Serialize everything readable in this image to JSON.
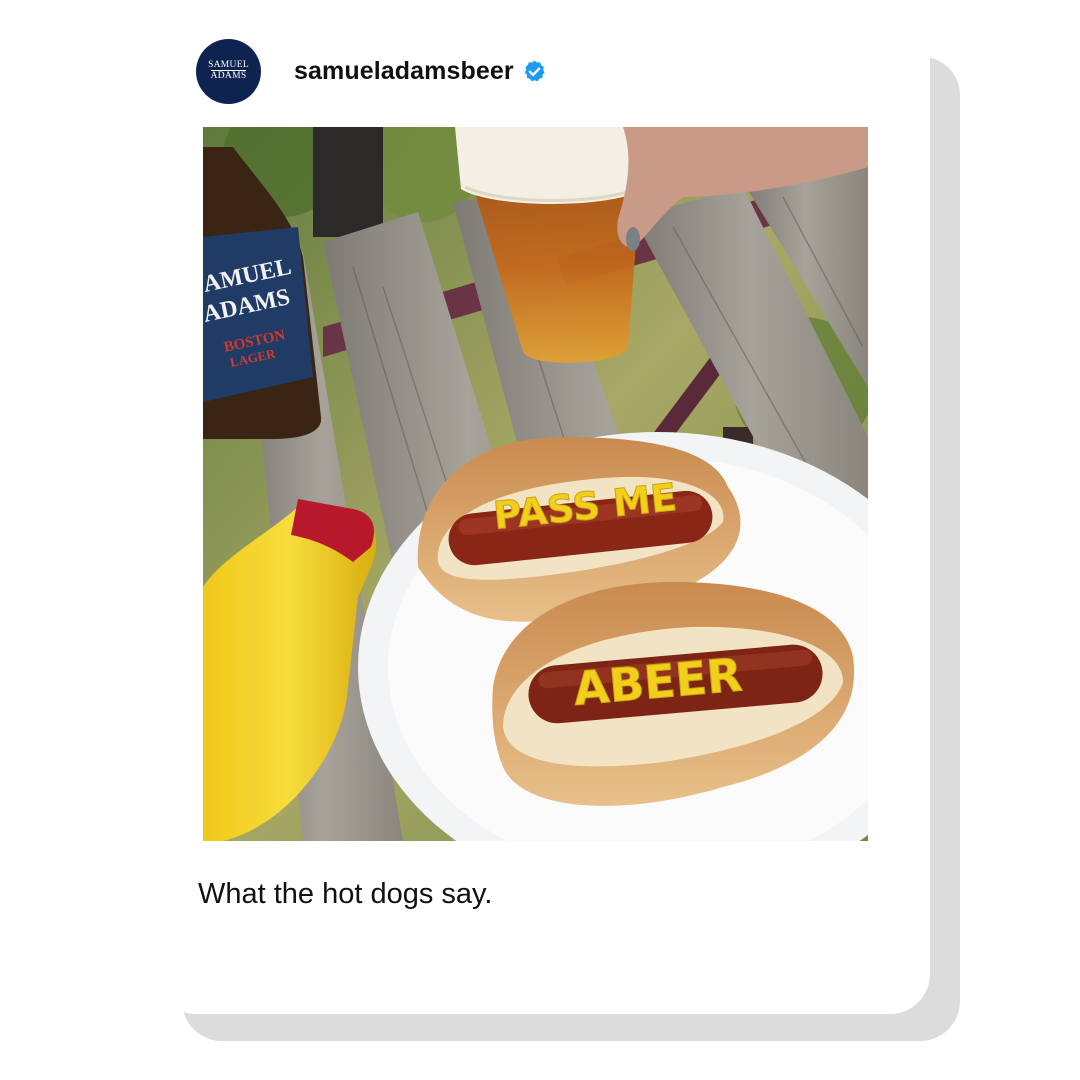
{
  "post": {
    "avatar": {
      "line1": "SAMUEL",
      "line2": "ADAMS"
    },
    "username": "samueladamsbeer",
    "verified": true,
    "caption": "What the hot dogs say.",
    "photo": {
      "bottle_text": [
        "AMUEL",
        "ADAMS",
        "BOSTON",
        "LAGER"
      ],
      "hotdog_messages": [
        "PASS ME",
        "ABEER"
      ]
    }
  },
  "colors": {
    "avatar_bg": "#0f2350",
    "verified_badge": "#1d9bf0",
    "mustard": "#f2cf1a",
    "shadow": "#dcdcdc"
  }
}
